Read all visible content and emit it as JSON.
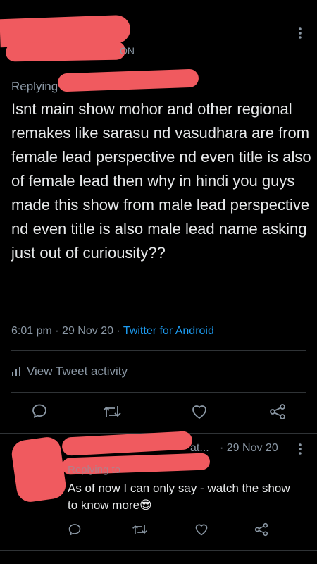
{
  "tweet": {
    "replying_label": "Replying",
    "text": "Isnt main show mohor and other regional remakes like sarasu nd vasudhara are from female lead perspective nd even title is also of female lead then why in hindi you guys made this show from male lead perspective nd even title is also male lead name asking just out of curiousity??",
    "time": "6:01 pm",
    "date": "29 Nov 20",
    "source": "Twitter for Android",
    "sep": "·",
    "activity_label": "View Tweet activity"
  },
  "reply": {
    "header_partial": "at...",
    "date_line": "· 29 Nov 20",
    "replying_label": "Replying to",
    "text": "As of now I can only say - watch the show to know more",
    "emoji": "😎"
  },
  "icons": {
    "more": "more-vertical-icon",
    "stats": "bar-chart-icon",
    "reply": "reply-icon",
    "retweet": "retweet-icon",
    "like": "heart-icon",
    "share": "share-icon"
  },
  "colors": {
    "background": "#000000",
    "text": "#e7e9ea",
    "muted": "#8b98a5",
    "link": "#1d9bf0",
    "redaction": "#f05a5f"
  }
}
